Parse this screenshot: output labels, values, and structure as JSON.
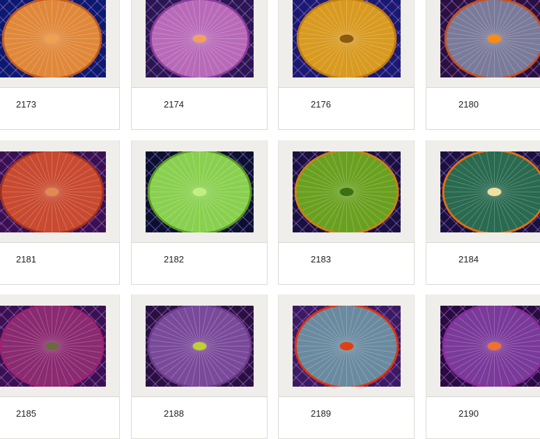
{
  "items": [
    {
      "id": "2173",
      "bg": "#0c1a6e",
      "rim": "#c05a20",
      "body": "#e0883a",
      "center": "#f0a050"
    },
    {
      "id": "2174",
      "bg": "#2a1650",
      "rim": "#8a3a9a",
      "body": "#b86ab8",
      "center": "#f0a060"
    },
    {
      "id": "2176",
      "bg": "#1a1a70",
      "rim": "#c07a10",
      "body": "#d89a20",
      "center": "#8a5a10"
    },
    {
      "id": "2180",
      "bg": "#2a1040",
      "rim": "#c85020",
      "body": "#7a7a9a",
      "center": "#ff8a10"
    },
    {
      "id": "2181",
      "bg": "#3a1050",
      "rim": "#a03020",
      "body": "#c84a30",
      "center": "#e08a50"
    },
    {
      "id": "2182",
      "bg": "#0a1030",
      "rim": "#5a9a20",
      "body": "#8ad050",
      "center": "#c0f080"
    },
    {
      "id": "2183",
      "bg": "#1a1040",
      "rim": "#d08010",
      "body": "#6aa020",
      "center": "#3a7010"
    },
    {
      "id": "2184",
      "bg": "#1a1040",
      "rim": "#e07010",
      "body": "#2a6a50",
      "center": "#f0e0a0"
    },
    {
      "id": "2185",
      "bg": "#3a1050",
      "rim": "#a02070",
      "body": "#8a2a70",
      "center": "#6a6a40"
    },
    {
      "id": "2188",
      "bg": "#2a1040",
      "rim": "#6a3a8a",
      "body": "#7a4a9a",
      "center": "#c0d030"
    },
    {
      "id": "2189",
      "bg": "#3a1a60",
      "rim": "#e03010",
      "body": "#6a8aa0",
      "center": "#e04010"
    },
    {
      "id": "2190",
      "bg": "#2a0a40",
      "rim": "#8a2a9a",
      "body": "#7a3a9a",
      "center": "#f07030"
    }
  ]
}
